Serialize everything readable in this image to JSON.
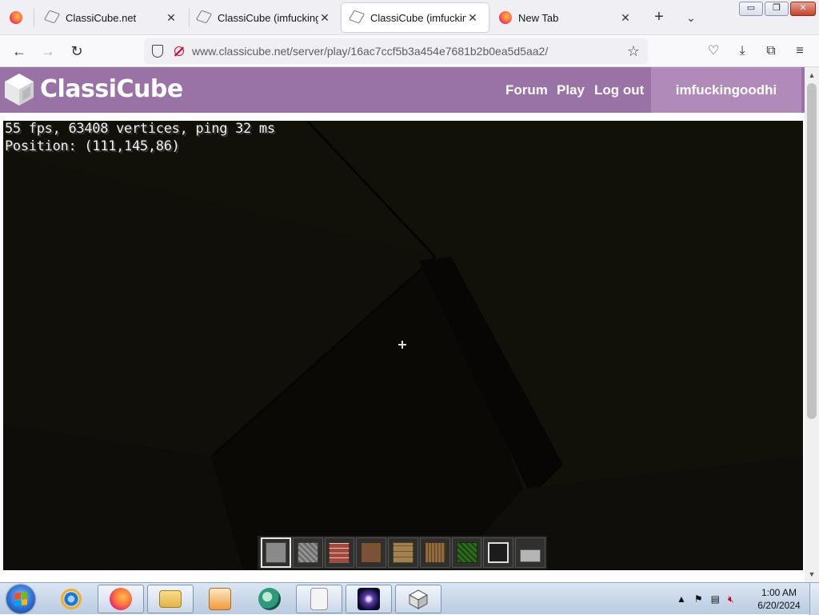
{
  "browser": {
    "tabs": [
      {
        "title": "ClassiCube.net",
        "icon": "cube-favicon",
        "active": false
      },
      {
        "title": "ClassiCube (imfuckingoodhi)",
        "icon": "cube-favicon",
        "active": false
      },
      {
        "title": "ClassiCube (imfuckingoodhi)",
        "icon": "cube-favicon",
        "active": true
      },
      {
        "title": "New Tab",
        "icon": "firefox-icon",
        "active": false
      }
    ],
    "url_host": "www.classicube.net",
    "url_path": "/server/play/16ac7ccf5b3a454e7681b2b0ea5d5aa2/",
    "window_buttons": {
      "minimize": "▭",
      "maximize": "❐",
      "close": "✕"
    }
  },
  "site": {
    "name": "ClassiCube",
    "nav": {
      "forum": "Forum",
      "play": "Play",
      "logout": "Log out"
    },
    "username": "imfuckingoodhi",
    "header_color": "#9a73a6",
    "user_color": "#b08ab9"
  },
  "game": {
    "stats_line": "55 fps, 63408 vertices, ping 32 ms",
    "position_line": "Position: (111,145,86)",
    "hotbar_selected_index": 0,
    "hotbar": [
      {
        "block": "stone",
        "color": "#8a8a8a"
      },
      {
        "block": "cobblestone",
        "color": "#6f6f6f"
      },
      {
        "block": "brick",
        "color": "#a8473a"
      },
      {
        "block": "dirt",
        "color": "#7a5236"
      },
      {
        "block": "wood-planks",
        "color": "#a2824f"
      },
      {
        "block": "log",
        "color": "#8f6b3e"
      },
      {
        "block": "leaves",
        "color": "#2f6b1f"
      },
      {
        "block": "glass",
        "color": "#1c1c1c"
      },
      {
        "block": "slab",
        "color": "#b5b5b5"
      }
    ]
  },
  "taskbar": {
    "apps": [
      {
        "name": "internet-explorer-icon",
        "open": false
      },
      {
        "name": "firefox-icon",
        "open": true
      },
      {
        "name": "file-explorer-icon",
        "open": true
      },
      {
        "name": "media-player-icon",
        "open": false
      },
      {
        "name": "app-swirl-icon",
        "open": false
      },
      {
        "name": "document-viewer-icon",
        "open": true
      },
      {
        "name": "galaxy-app-icon",
        "open": true
      },
      {
        "name": "classicube-icon",
        "open": true
      }
    ],
    "clock_time": "1:00 AM",
    "clock_date": "6/20/2024"
  }
}
